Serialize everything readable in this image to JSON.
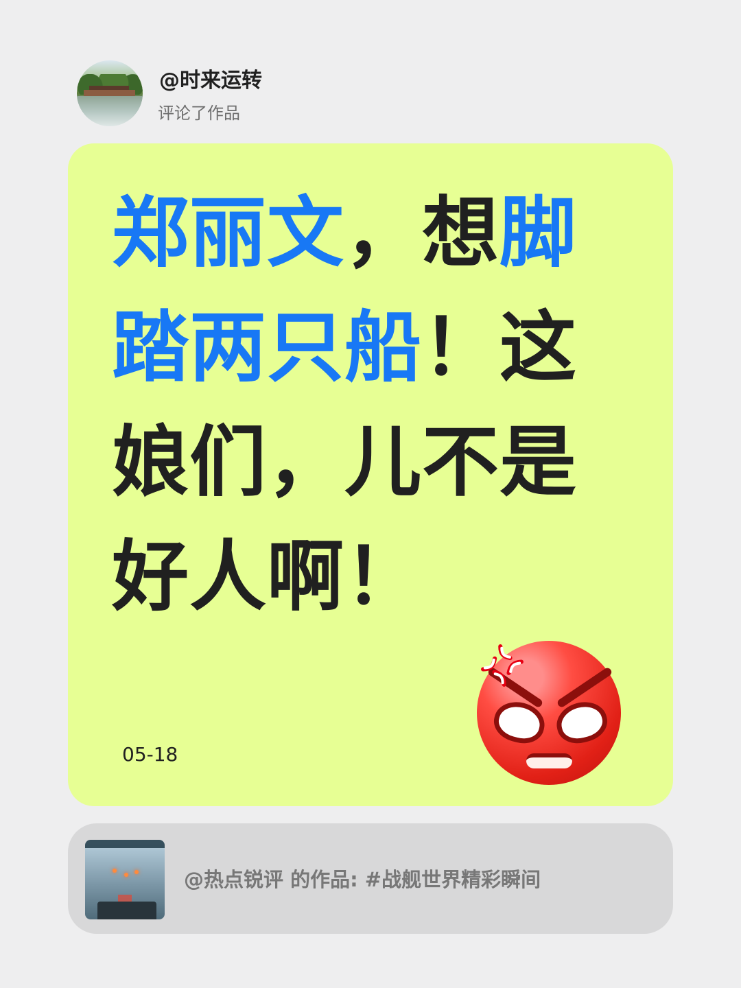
{
  "header": {
    "username": "@时来运转",
    "action": "评论了作品"
  },
  "comment": {
    "lines": [
      [
        {
          "text": "郑丽文",
          "tone": "blue"
        },
        {
          "text": "，想",
          "tone": "black"
        },
        {
          "text": "脚",
          "tone": "blue"
        }
      ],
      [
        {
          "text": "踏两只船",
          "tone": "blue"
        },
        {
          "text": "！这",
          "tone": "black"
        }
      ],
      [
        {
          "text": "娘们，儿不是",
          "tone": "black"
        }
      ],
      [
        {
          "text": "好人啊！",
          "tone": "black"
        }
      ]
    ],
    "date": "05-18",
    "emoji": "angry-face-with-anger-symbol"
  },
  "linked_work": {
    "text": "@热点锐评 的作品: #战舰世界精彩瞬间",
    "thumbnail": "battleship-video-thumbnail"
  },
  "colors": {
    "background": "#eeeeef",
    "card": "#e7ff94",
    "highlight_blue": "#1878f5",
    "dark_text": "#202020",
    "link_card": "#d8d8d9"
  }
}
